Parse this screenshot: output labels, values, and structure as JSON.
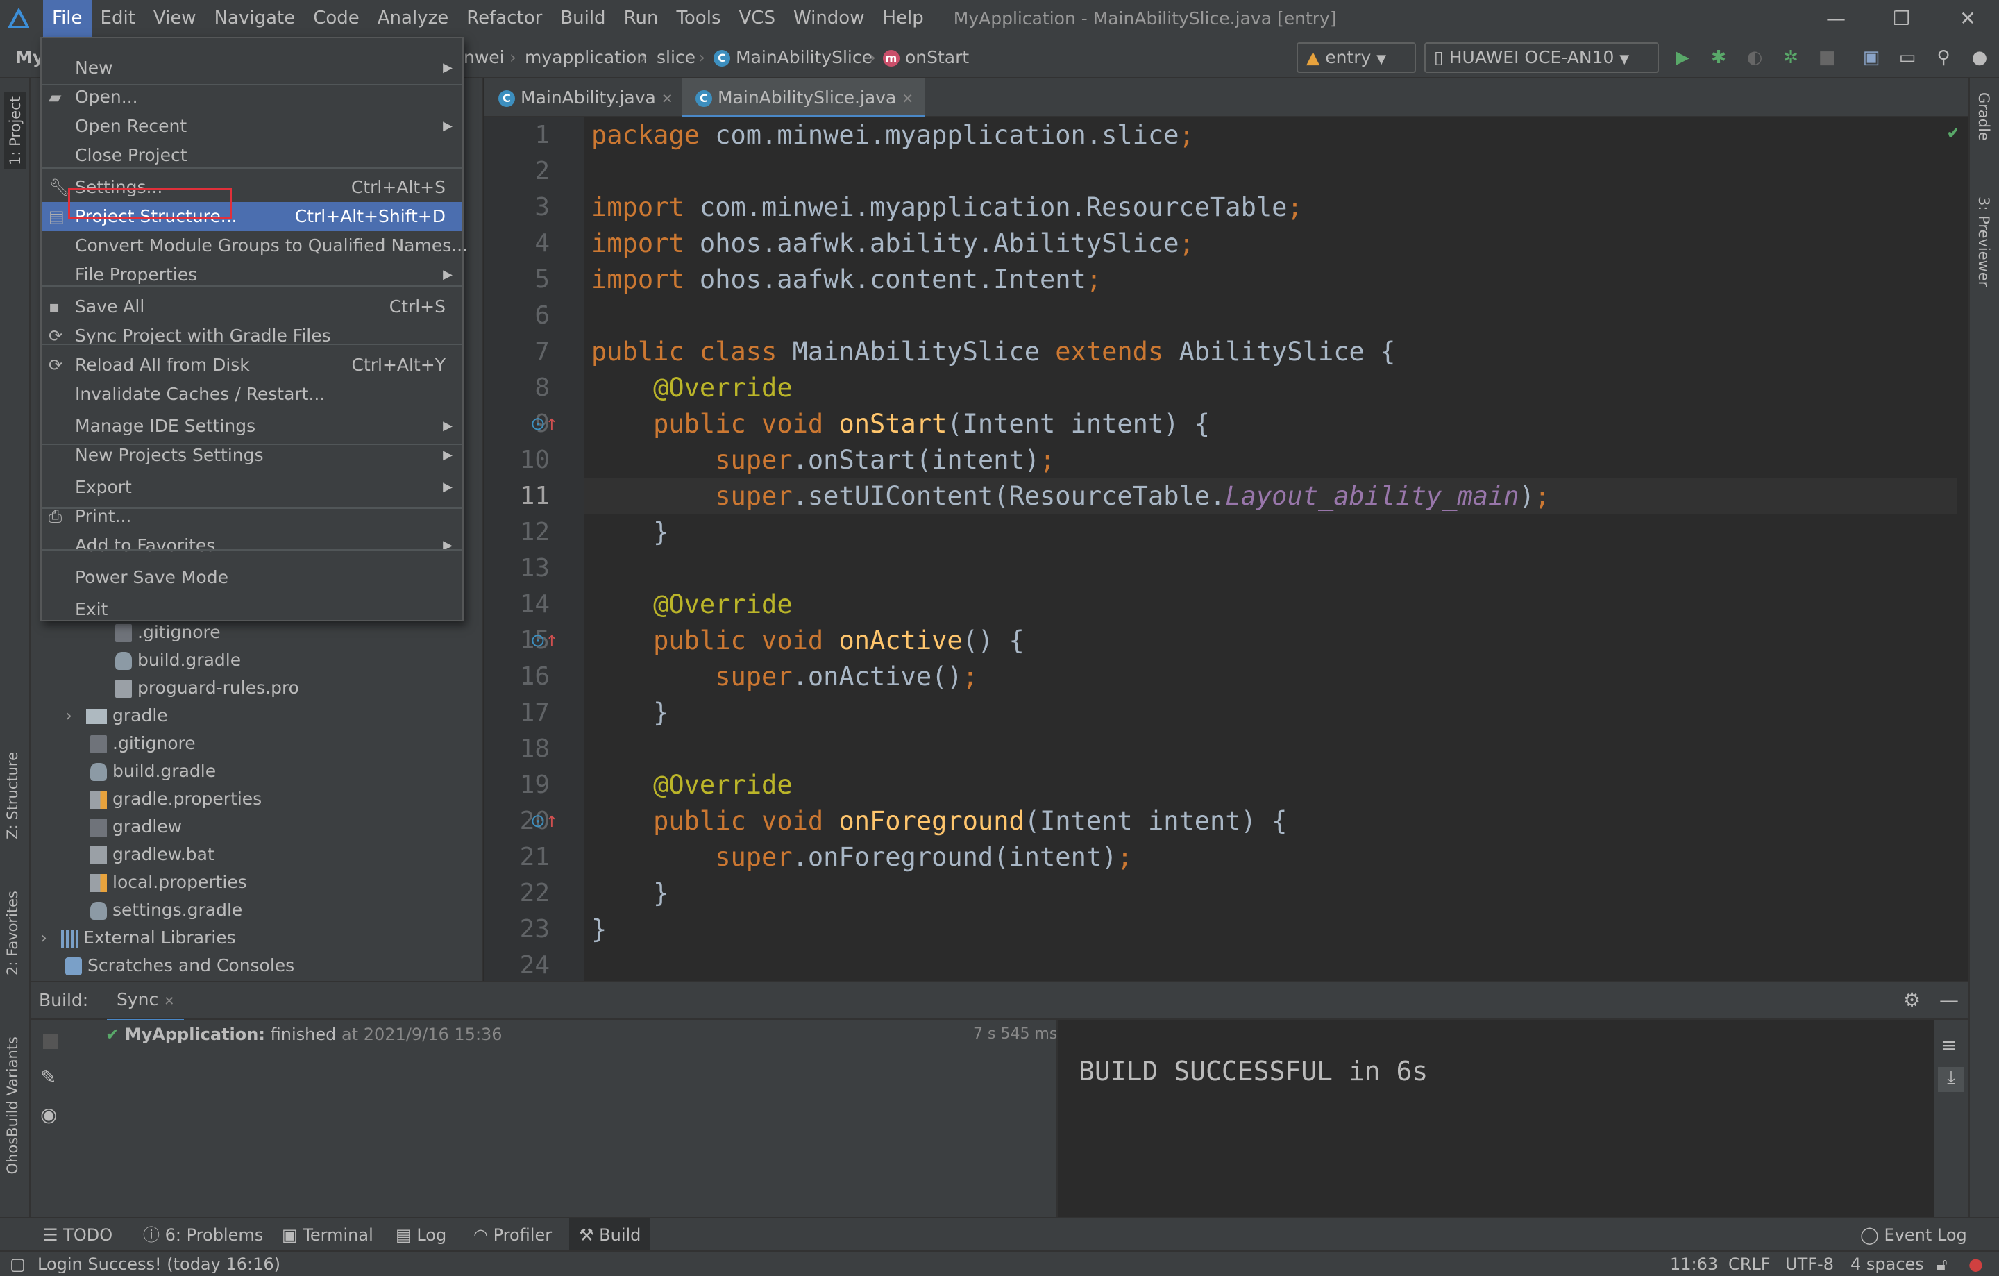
{
  "menubar": {
    "items": [
      "File",
      "Edit",
      "View",
      "Navigate",
      "Code",
      "Analyze",
      "Refactor",
      "Build",
      "Run",
      "Tools",
      "VCS",
      "Window",
      "Help"
    ],
    "window_title": "MyApplication - MainAbilitySlice.java [entry]"
  },
  "navbar": {
    "project_label": "My",
    "breadcrumbs": [
      "nwei",
      "myapplication",
      "slice",
      "MainAbilitySlice",
      "onStart"
    ],
    "module_selector": "entry",
    "device_selector": "HUAWEI OCE-AN10"
  },
  "file_menu": {
    "items": [
      {
        "label": "New",
        "shortcut": "",
        "submenu": true
      },
      {
        "label": "Open...",
        "shortcut": "",
        "submenu": false
      },
      {
        "label": "Open Recent",
        "shortcut": "",
        "submenu": true
      },
      {
        "label": "Close Project",
        "shortcut": "",
        "submenu": false
      },
      {
        "label": "Settings...",
        "shortcut": "Ctrl+Alt+S",
        "submenu": false
      },
      {
        "label": "Project Structure...",
        "shortcut": "Ctrl+Alt+Shift+D",
        "submenu": false
      },
      {
        "label": "Convert Module Groups to Qualified Names...",
        "shortcut": "",
        "submenu": false
      },
      {
        "label": "File Properties",
        "shortcut": "",
        "submenu": true
      },
      {
        "label": "Save All",
        "shortcut": "Ctrl+S",
        "submenu": false
      },
      {
        "label": "Sync Project with Gradle Files",
        "shortcut": "",
        "submenu": false
      },
      {
        "label": "Reload All from Disk",
        "shortcut": "Ctrl+Alt+Y",
        "submenu": false
      },
      {
        "label": "Invalidate Caches / Restart...",
        "shortcut": "",
        "submenu": false
      },
      {
        "label": "Manage IDE Settings",
        "shortcut": "",
        "submenu": true
      },
      {
        "label": "New Projects Settings",
        "shortcut": "",
        "submenu": true
      },
      {
        "label": "Export",
        "shortcut": "",
        "submenu": true
      },
      {
        "label": "Print...",
        "shortcut": "",
        "submenu": false
      },
      {
        "label": "Add to Favorites",
        "shortcut": "",
        "submenu": true
      },
      {
        "label": "Power Save Mode",
        "shortcut": "",
        "submenu": false
      },
      {
        "label": "Exit",
        "shortcut": "",
        "submenu": false
      }
    ]
  },
  "project_tree": [
    ".gitignore",
    "build.gradle",
    "proguard-rules.pro",
    "gradle",
    ".gitignore",
    "build.gradle",
    "gradle.properties",
    "gradlew",
    "gradlew.bat",
    "local.properties",
    "settings.gradle",
    "External Libraries",
    "Scratches and Consoles"
  ],
  "editor": {
    "tabs": [
      "MainAbility.java",
      "MainAbilitySlice.java"
    ],
    "line_numbers": [
      "1",
      "2",
      "3",
      "4",
      "5",
      "6",
      "7",
      "8",
      "9",
      "10",
      "11",
      "12",
      "13",
      "14",
      "15",
      "16",
      "17",
      "18",
      "19",
      "20",
      "21",
      "22",
      "23",
      "24"
    ],
    "current_line": 11
  },
  "build_panel": {
    "label": "Build:",
    "tab": "Sync",
    "project": "MyApplication:",
    "status": "finished",
    "time": "at 2021/9/16 15:36",
    "duration": "7 s 545 ms",
    "output": "BUILD SUCCESSFUL in 6s"
  },
  "left_strip": [
    "1: Project",
    "Z: Structure",
    "2: Favorites",
    "OhosBuild Variants"
  ],
  "right_strip": [
    "Gradle",
    "3: Previewer"
  ],
  "tool_windows": [
    "TODO",
    "6: Problems",
    "Terminal",
    "Log",
    "Profiler",
    "Build",
    "Event Log"
  ],
  "status_bar": {
    "message": "Login Success! (today 16:16)",
    "position": "11:63",
    "line_sep": "CRLF",
    "encoding": "UTF-8",
    "indent": "4 spaces"
  }
}
